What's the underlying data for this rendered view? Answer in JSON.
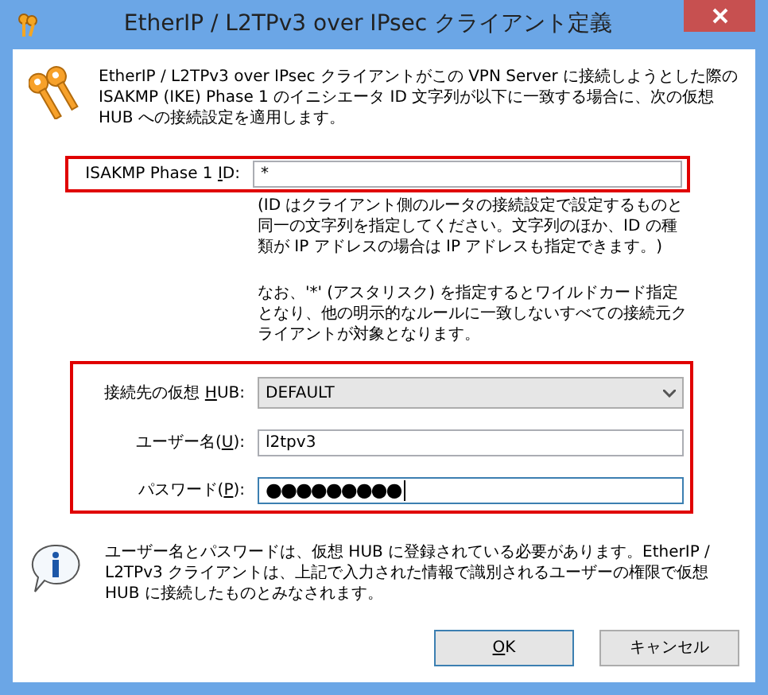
{
  "window": {
    "title": "EtherIP / L2TPv3 over IPsec クライアント定義"
  },
  "intro": "EtherIP / L2TPv3 over IPsec クライアントがこの VPN Server に接続しようとした際の ISAKMP (IKE) Phase 1 のイニシエータ ID 文字列が以下に一致する場合に、次の仮想 HUB への接続設定を適用します。",
  "id_field": {
    "label_before": "ISAKMP Phase 1 ",
    "mnemonic": "I",
    "label_after": "D:",
    "value": "*",
    "focused": false
  },
  "notes": [
    "(ID はクライアント側のルータの接続設定で設定するものと同一の文字列を指定してください。文字列のほか、ID の種類が IP アドレスの場合は IP アドレスも指定できます。)",
    "なお、'*' (アスタリスク) を指定するとワイルドカード指定となり、他の明示的なルールに一致しないすべての接続元クライアントが対象となります。"
  ],
  "fields": [
    {
      "kind": "dropdown",
      "label_before": "接続先の仮想 ",
      "mnemonic": "H",
      "label_after": "UB:",
      "value": "DEFAULT",
      "focused": false
    },
    {
      "kind": "text",
      "label_before": "ユーザー名(",
      "mnemonic": "U",
      "label_after": "):",
      "value": "l2tpv3",
      "focused": false
    },
    {
      "kind": "password",
      "label_before": "パスワード(",
      "mnemonic": "P",
      "label_after": "):",
      "value": "●●●●●●●●●",
      "focused": true
    }
  ],
  "info": "ユーザー名とパスワードは、仮想 HUB に登録されている必要があります。EtherIP / L2TPv3 クライアントは、上記で入力された情報で識別されるユーザーの権限で仮想 HUB に接続したものとみなされます。",
  "buttons": [
    {
      "mnemonic": "O",
      "label_after": "K",
      "default": true
    },
    {
      "label_after": "キャンセル",
      "default": false
    }
  ]
}
